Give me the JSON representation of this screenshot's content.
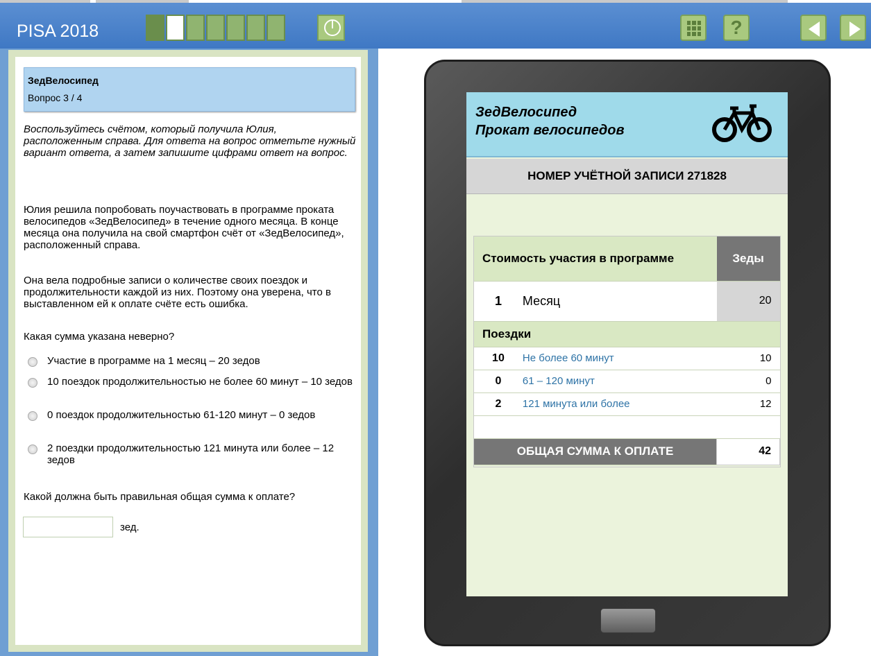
{
  "header": {
    "brand": "PISA 2018",
    "progress": {
      "total_segments": 7,
      "current": 2
    }
  },
  "question": {
    "unit": "ЗедВелосипед",
    "number": "Вопрос 3 / 4",
    "instruction": "Воспользуйтесь счётом, который получила Юлия, расположенным справа. Для ответа на вопрос отметьте нужный вариант ответа, а затем запишите цифрами ответ на вопрос.",
    "paragraph1": "Юлия решила попробовать поучаствовать в программе проката велосипедов «ЗедВелосипед» в течение одного месяца. В конце месяца она получила на свой смартфон счёт от «ЗедВелосипед», расположенный справа.",
    "paragraph2": "Она вела подробные записи о количестве своих поездок и продолжительности каждой из них. Поэтому она уверена, что в выставленном ей к оплате счёте есть ошибка.",
    "prompt1": "Какая сумма указана неверно?",
    "options": [
      "Участие в программе на 1 месяц – 20 зедов",
      "10 поездок продолжительностью не более 60 минут – 10 зедов",
      "0 поездок продолжительностью 61-120 минут – 0 зедов",
      "2 поездки продолжительностью 121 минута или более – 12 зедов"
    ],
    "prompt2": "Какой должна быть правильная общая сумма к оплате?",
    "answer_value": "",
    "answer_unit": "зед."
  },
  "bill": {
    "company_line1": "ЗедВелосипед",
    "company_line2": "Прокат велосипедов",
    "account": "НОМЕР УЧЁТНОЙ ЗАПИСИ 271828",
    "membership_header": "Стоимость участия в программе",
    "currency_header": "Зеды",
    "month_qty": "1",
    "month_label": "Месяц",
    "month_cost": "20",
    "trips_header": "Поездки",
    "trips": [
      {
        "qty": "10",
        "label": "Не более 60 минут",
        "cost": "10"
      },
      {
        "qty": "0",
        "label": "61 – 120 минут",
        "cost": "0"
      },
      {
        "qty": "2",
        "label": "121 минута или более",
        "cost": "12"
      }
    ],
    "total_label": "ОБЩАЯ СУММА К ОПЛАТЕ",
    "total_value": "42"
  },
  "colors": {
    "header_blue": "#4a82ca",
    "progress_green": "#90b470",
    "bill_header_green": "#d9e8c3",
    "screen_cyan": "#9fdaea",
    "link_blue": "#2e73a6"
  },
  "icons": [
    "timer-icon",
    "calculator-icon",
    "help-icon",
    "previous-arrow-icon",
    "next-arrow-icon",
    "bicycle-icon",
    "radio-button-icon"
  ]
}
